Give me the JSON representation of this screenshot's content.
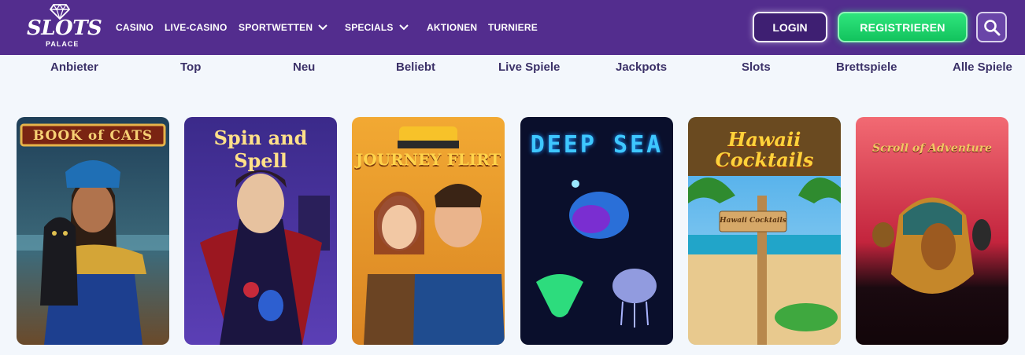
{
  "brand": {
    "logo_line1": "SLOTS",
    "logo_line2": "PALACE"
  },
  "nav": {
    "items": [
      {
        "label": "CASINO"
      },
      {
        "label": "LIVE-CASINO"
      },
      {
        "label": "SPORTWETTEN",
        "dropdown": true
      },
      {
        "label": "SPECIALS",
        "dropdown": true
      },
      {
        "label": "AKTIONEN"
      },
      {
        "label": "TURNIERE"
      }
    ],
    "login_label": "LOGIN",
    "register_label": "REGISTRIEREN",
    "search_icon": "search-icon"
  },
  "categories": [
    "Anbieter",
    "Top",
    "Neu",
    "Beliebt",
    "Live Spiele",
    "Jackpots",
    "Slots",
    "Brettspiele",
    "Alle Spiele"
  ],
  "games": [
    {
      "title": "BOOK of CATS"
    },
    {
      "title": "Spin and Spell"
    },
    {
      "title": "JOURNEY FLIRT"
    },
    {
      "title": "DEEP SEA"
    },
    {
      "title": "Hawaii Cocktails",
      "sign_text": "Hawaii Cocktails"
    },
    {
      "title": "Scroll of Adventure"
    }
  ],
  "colors": {
    "header_bg": "#532d8e",
    "register_green": "#1fd36b",
    "page_bg": "#f3f7fc",
    "category_text": "#3b3168"
  }
}
